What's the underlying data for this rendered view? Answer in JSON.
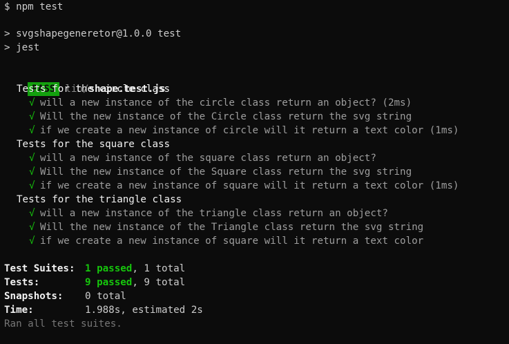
{
  "terminal": {
    "command_line": "$ npm test",
    "script_header": "> svgshapegeneretor@1.0.0 test",
    "script_cmd": "> jest",
    "result": {
      "badge": "PASS",
      "file_dir": "lib/",
      "file_name": "shape.test.js"
    },
    "suites": [
      {
        "name": "Tests for the circle class",
        "tests": [
          "will a new instance of the circle class return an object? (2ms)",
          "Will the new instance of the Circle class return the svg string",
          "if we create a new instance of circle will it return a text color (1ms)"
        ]
      },
      {
        "name": "Tests for the square class",
        "tests": [
          "will a new instance of the square class return an object?",
          "Will the new instance of the Square class return the svg string",
          "if we create a new instance of square will it return a text color (1ms)"
        ]
      },
      {
        "name": "Tests for the triangle class",
        "tests": [
          "will a new instance of the triangle class return an object?",
          "Will the new instance of the Triangle class return the svg string",
          "if we create a new instance of square will it return a text color"
        ]
      }
    ],
    "check_glyph": "√",
    "summary": {
      "suites_label": "Test Suites:",
      "suites_passed": "1 passed",
      "suites_total": ", 1 total",
      "tests_label": "Tests:",
      "tests_passed": "9 passed",
      "tests_total": ", 9 total",
      "snapshots_label": "Snapshots:",
      "snapshots_value": "0 total",
      "time_label": "Time:",
      "time_value": "1.988s, estimated 2s",
      "footer": "Ran all test suites."
    }
  },
  "colors": {
    "background": "#0c0c0c",
    "pass_badge": "#13a10e",
    "check_green": "#16c60c"
  }
}
